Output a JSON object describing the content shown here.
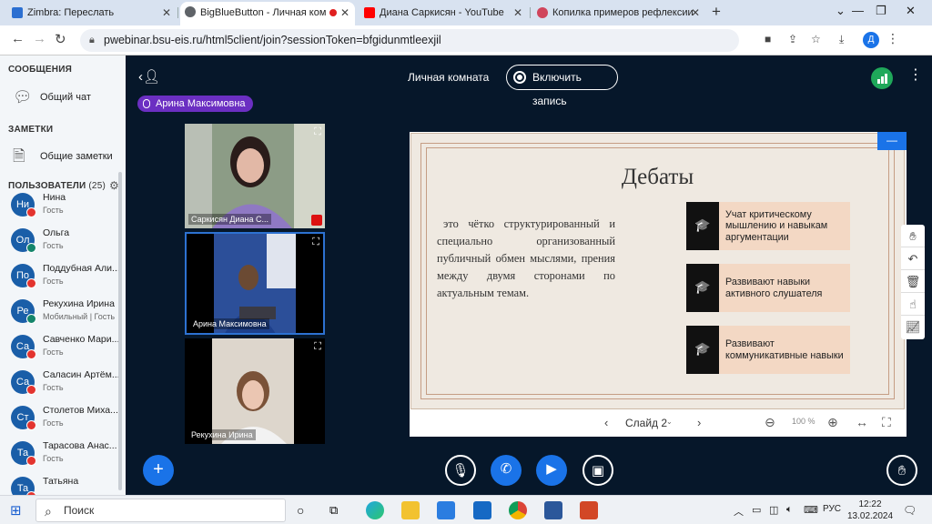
{
  "browser": {
    "tabs": [
      {
        "title": "Zimbra: Переслать",
        "favicon_color": "#2c6fd1"
      },
      {
        "title": "BigBlueButton - Личная ком",
        "favicon_color": "#5f6368"
      },
      {
        "title": "Диана Саркисян - YouTube",
        "favicon_color": "#ff0000"
      },
      {
        "title": "Копилка примеров рефлексии",
        "favicon_color": "#d0455c"
      }
    ],
    "new_tab": "+",
    "url": "pwebinar.bsu-eis.ru/html5client/join?sessionToken=bfgidunmtleexjil",
    "profile_initial": "Д"
  },
  "sidebar": {
    "messages_title": "СООБЩЕНИЯ",
    "public_chat": "Общий чат",
    "notes_title": "ЗАМЕТКИ",
    "shared_notes": "Общие заметки",
    "users_title": "ПОЛЬЗОВАТЕЛИ",
    "users_count": "(25)",
    "users": [
      {
        "initials": "Ни",
        "name": "Нина",
        "role": "Гость",
        "muted": true
      },
      {
        "initials": "Ол",
        "name": "Ольга",
        "role": "Гость",
        "muted": false
      },
      {
        "initials": "По",
        "name": "Поддубная Али...",
        "role": "Гость",
        "muted": true
      },
      {
        "initials": "Ре",
        "name": "Рекухина Ирина",
        "role": "Мобильный | Гость",
        "muted": false
      },
      {
        "initials": "Са",
        "name": "Савченко Мари...",
        "role": "Гость",
        "muted": true
      },
      {
        "initials": "Са",
        "name": "Саласин Артём...",
        "role": "Гость",
        "muted": true
      },
      {
        "initials": "Ст",
        "name": "Столетов Миха...",
        "role": "Гость",
        "muted": true
      },
      {
        "initials": "Та",
        "name": "Тарасова Анас...",
        "role": "Гость",
        "muted": true
      },
      {
        "initials": "Та",
        "name": "Татьяна",
        "role": "",
        "muted": true
      }
    ]
  },
  "main": {
    "room_name": "Личная комната",
    "record_label": "Включить запись",
    "talking_user": "Арина Максимовна",
    "videos": [
      {
        "name": "Саркисян Диана С...",
        "bg": "#7e8f7a"
      },
      {
        "name": "Арина Максимовна",
        "bg": "#1b2c5a"
      },
      {
        "name": "Рекухина Ирина",
        "bg": "#c9c1b6"
      }
    ]
  },
  "slide": {
    "title": "Дебаты",
    "body": "это чётко структурированный и специально организованный публичный обмен мыслями, прения между двумя сторонами по актуальным темам.",
    "cards": [
      "Учат критическому мышлению и навыкам аргументации",
      "Развивают навыки активного слушателя",
      "Развивают коммуникативные навыки"
    ],
    "slide_label": "Слайд 2",
    "zoom": "100 %"
  },
  "taskbar": {
    "search_placeholder": "Поиск",
    "lang": "РУС",
    "time": "12:22",
    "date": "13.02.2024"
  }
}
